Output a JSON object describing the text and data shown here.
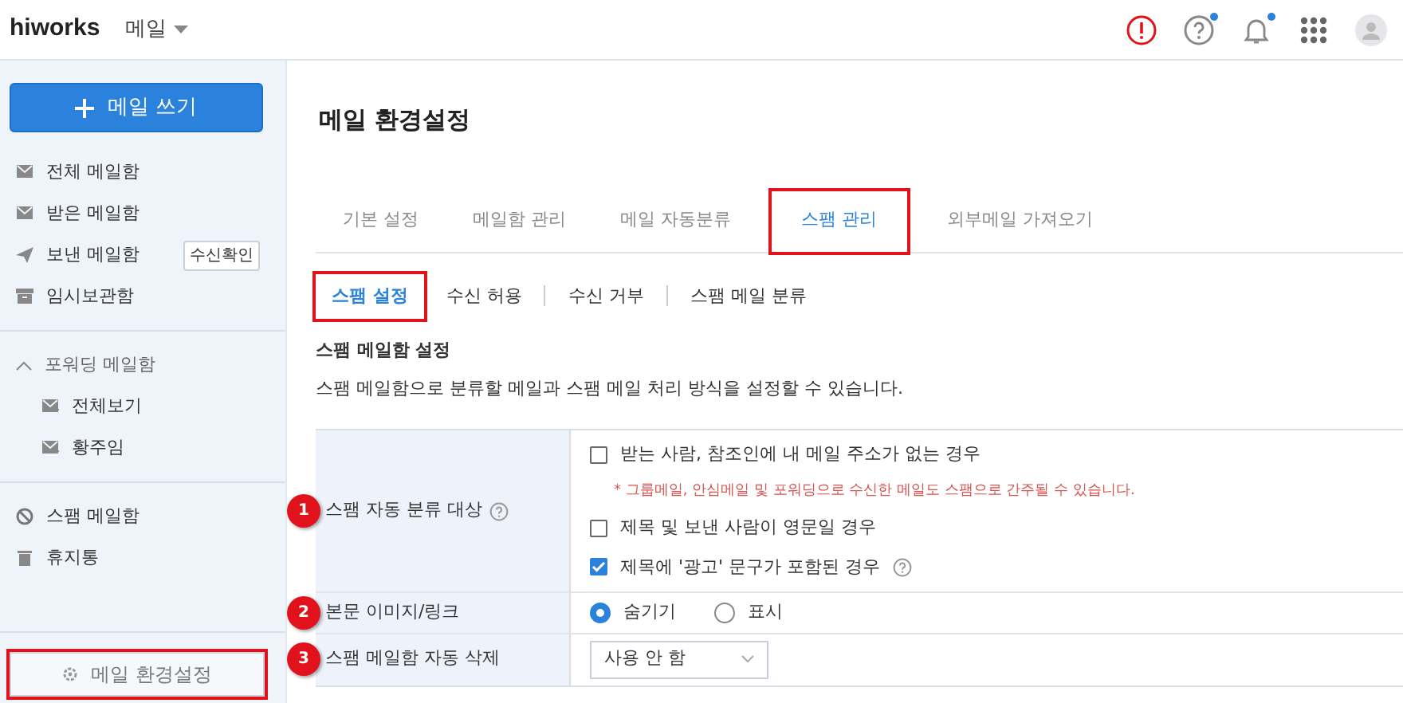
{
  "header": {
    "logo": "hiworks",
    "app_menu": "메일",
    "icons": [
      {
        "kind": "alert"
      },
      {
        "kind": "help",
        "dot": true
      },
      {
        "kind": "bell",
        "dot": true
      },
      {
        "kind": "apps"
      },
      {
        "kind": "avatar"
      }
    ]
  },
  "sidebar": {
    "compose_button": "메일 쓰기",
    "mailboxes": [
      {
        "kind": "all",
        "label": "전체 메일함"
      },
      {
        "kind": "inbox",
        "label": "받은 메일함"
      },
      {
        "kind": "sent",
        "label": "보낸 메일함",
        "badge": "수신확인"
      },
      {
        "kind": "drafts",
        "label": "임시보관함"
      }
    ],
    "forwarding": {
      "label": "포워딩 메일함",
      "expanded": true,
      "children": [
        {
          "label": "전체보기"
        },
        {
          "label": "황주임"
        }
      ]
    },
    "others": [
      {
        "kind": "spam",
        "label": "스팸 메일함"
      },
      {
        "kind": "trash",
        "label": "휴지통"
      }
    ],
    "settings_button": {
      "label": "메일 환경설정",
      "highlighted": true
    }
  },
  "page_title": "메일 환경설정",
  "tabs": [
    {
      "label": "기본 설정",
      "selected": false,
      "highlighted": false
    },
    {
      "label": "메일함 관리",
      "selected": false,
      "highlighted": false
    },
    {
      "label": "메일 자동분류",
      "selected": false,
      "highlighted": false
    },
    {
      "label": "스팸 관리",
      "selected": true,
      "highlighted": true
    },
    {
      "label": "외부메일 가져오기",
      "selected": false,
      "highlighted": false
    }
  ],
  "subtabs": [
    {
      "label": "스팸 설정",
      "selected": true,
      "highlighted": true
    },
    {
      "label": "수신 허용",
      "selected": false,
      "highlighted": false
    },
    {
      "label": "수신 거부",
      "selected": false,
      "highlighted": false
    },
    {
      "label": "스팸 메일 분류",
      "selected": false,
      "highlighted": false
    }
  ],
  "section_title": "스팸 메일함 설정",
  "section_description": "스팸 메일함으로 분류할 메일과 스팸 메일 처리 방식을 설정할 수 있습니다.",
  "settings": [
    {
      "marker": "1",
      "label": "스팸 자동 분류 대상",
      "help": true,
      "options": [
        {
          "kind": "checkbox",
          "label": "받는 사람, 참조인에 내 메일 주소가 없는 경우",
          "checked": false
        },
        {
          "kind": "note",
          "label": "* 그룹메일, 안심메일 및 포워딩으로 수신한 메일도 스팸으로 간주될 수 있습니다."
        },
        {
          "kind": "checkbox",
          "label": "제목 및 보낸 사람이 영문일 경우",
          "checked": false
        },
        {
          "kind": "checkbox",
          "label": "제목에 '광고' 문구가 포함된 경우",
          "checked": true,
          "help": true
        }
      ]
    },
    {
      "marker": "2",
      "label": "본문 이미지/링크",
      "options": [
        {
          "kind": "radio",
          "label": "숨기기",
          "selected": true
        },
        {
          "kind": "radio",
          "label": "표시",
          "selected": false
        }
      ]
    },
    {
      "marker": "3",
      "label": "스팸 메일함 자동 삭제",
      "options": [
        {
          "kind": "select",
          "value": "사용 안 함"
        }
      ]
    }
  ]
}
